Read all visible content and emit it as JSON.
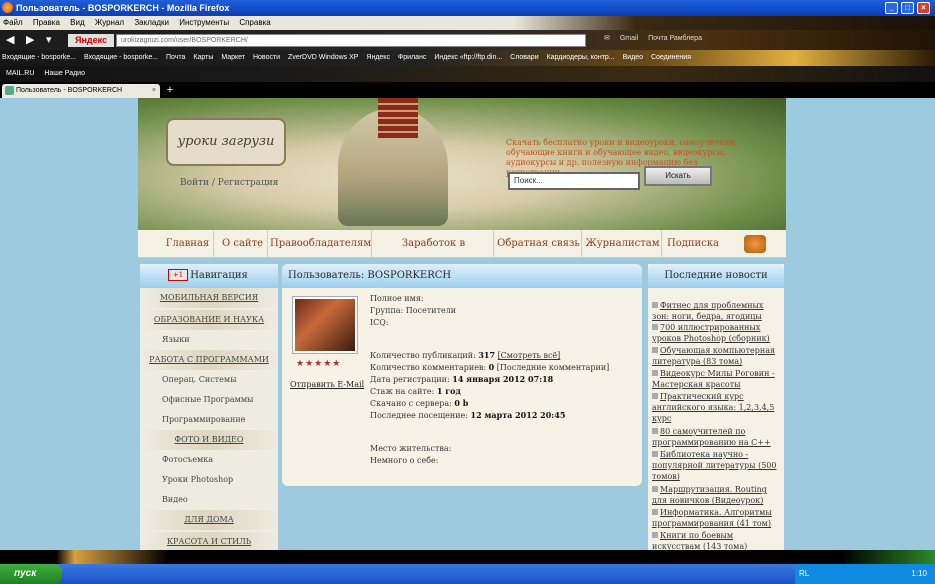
{
  "window": {
    "title": "Пользователь - BOSPORKERCH - Mozilla Firefox",
    "controls": [
      "_",
      "□",
      "×"
    ]
  },
  "menu": [
    "Файл",
    "Правка",
    "Вид",
    "Журнал",
    "Закладки",
    "Инструменты",
    "Справка"
  ],
  "nav": {
    "engine": "Яндекс",
    "url": "urokizagruzi.com/user/BOSPORKERCH/",
    "right_items": [
      "Gmail",
      "Почта Рамблера"
    ]
  },
  "bookmarks": [
    "Входящие - bosporke...",
    "Входящие - bosporke...",
    "Почта",
    "Карты",
    "Маркет",
    "Новости",
    "ZverDVD Windows XP",
    "Яндекс",
    "Фриланс",
    "Индекс «ftp://ftp.din...",
    "Словари",
    "Кардиодеры, контр...",
    "Видео",
    "Соединения"
  ],
  "toolbar2": [
    "MAIL.RU",
    "Наше Радио"
  ],
  "tab": {
    "label": "Пользователь - BOSPORKERCH"
  },
  "site": {
    "login": "Войти / Регистрация",
    "promo": "Скачать бесплатно уроки и видеоуроки, самоучители, обучающие книги и обучающее видео, видеокурсы, аудиокурсы и др. полезную информацию без регистрации",
    "search_placeholder": "Поиск...",
    "search_btn": "Искать",
    "topnav": [
      "Главная",
      "О сайте",
      "Правообладателям",
      "Заработок в интернете",
      "Обратная связь",
      "Журналистам",
      "Подписка"
    ]
  },
  "sidebar": {
    "title": "Навигация",
    "plus": "+1",
    "items": [
      {
        "label": "МОБИЛЬНАЯ ВЕРСИЯ",
        "type": "sec"
      },
      {
        "label": "ОБРАЗОВАНИЕ И НАУКА",
        "type": "sec"
      },
      {
        "label": "Языки",
        "type": "sub"
      },
      {
        "label": "РАБОТА С ПРОГРАММАМИ",
        "type": "sec"
      },
      {
        "label": "Операц. Системы",
        "type": "sub"
      },
      {
        "label": "Офисные Программы",
        "type": "sub"
      },
      {
        "label": "Программирование",
        "type": "sub"
      },
      {
        "label": "ФОТО И ВИДЕО",
        "type": "sec"
      },
      {
        "label": "Фотосъемка",
        "type": "sub"
      },
      {
        "label": "Уроки Photoshop",
        "type": "sub"
      },
      {
        "label": "Видео",
        "type": "sub"
      },
      {
        "label": "ДЛЯ ДОМА",
        "type": "sec"
      },
      {
        "label": "КРАСОТА И СТИЛЬ",
        "type": "sec"
      }
    ]
  },
  "profile": {
    "heading": "Пользователь: BOSPORKERCH",
    "send_email": "Отправить E-Mail",
    "stars": "★★★★★",
    "fields": [
      {
        "label": "Полное имя:",
        "value": ""
      },
      {
        "label": "Группа: Посетители",
        "value": ""
      },
      {
        "label": "ICQ:",
        "value": ""
      },
      {
        "label": "",
        "value": ""
      },
      {
        "label": "Количество публикаций:",
        "value": "317",
        "extra": "[Смотреть всё]"
      },
      {
        "label": "Количество комментариев:",
        "value": "0",
        "extra": "[Последние комментарии]"
      },
      {
        "label": "Дата регистрации:",
        "value": "14 января 2012 07:18"
      },
      {
        "label": "Стаж на сайте:",
        "value": "1 год"
      },
      {
        "label": "Скачано с сервера:",
        "value": "0 b"
      },
      {
        "label": "Последнее посещение:",
        "value": "12 марта 2012 20:45"
      },
      {
        "label": "",
        "value": ""
      },
      {
        "label": "",
        "value": ""
      },
      {
        "label": "Место жительства:",
        "value": ""
      },
      {
        "label": "Немного о себе:",
        "value": ""
      }
    ]
  },
  "news": {
    "title": "Последние новости",
    "items": [
      "Фитнес для проблемных зон: ноги, бедра, ягодицы",
      "700 иллюстрированных уроков Photoshop (сборник)",
      "Обучающая компьютерная литература (83 тома)",
      "Видеокурс Милы Роговин - Мастерская красоты",
      "Практический курс английского языка: 1,2,3,4,5 курс",
      "80 самоучителей по программированию на C++",
      "Библиотека научно - популярной литературы (500 томов)",
      "Маршрутизация. Routing для новичков (Видеоурок)",
      "Информатика. Алгоритмы программирования (41 том)",
      "Книги по боевым искусствам (143 тома)"
    ]
  },
  "taskbar": {
    "start": "пуск",
    "lang": "RL",
    "clock": "1:10"
  }
}
